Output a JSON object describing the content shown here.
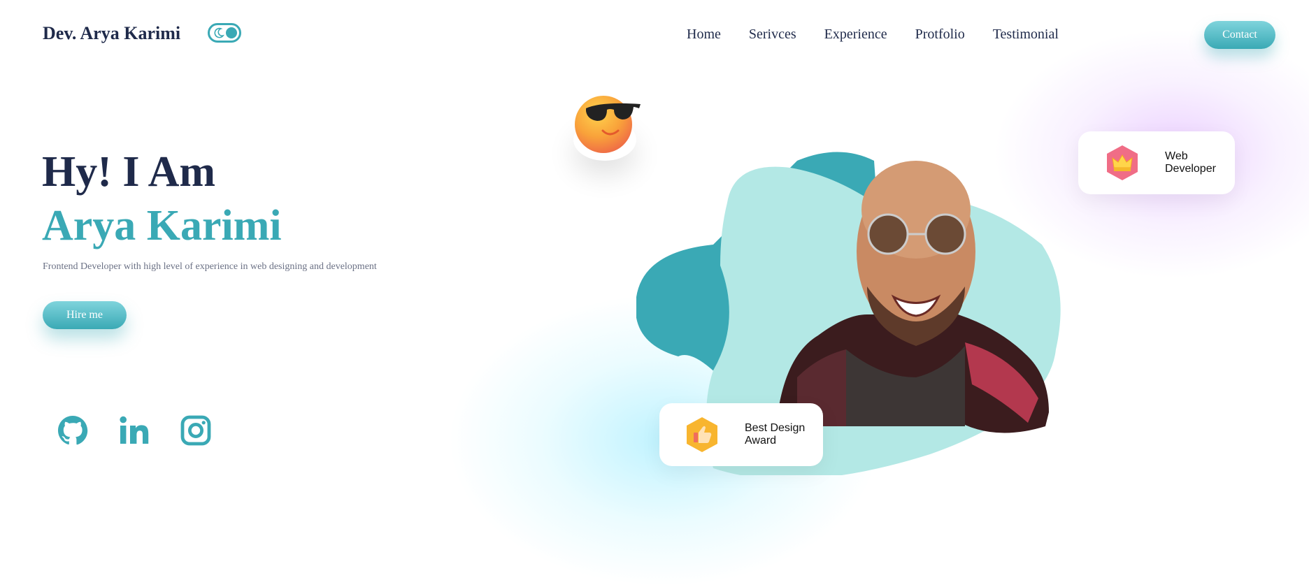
{
  "header": {
    "logo": "Dev. Arya Karimi",
    "nav": [
      "Home",
      "Serivces",
      "Experience",
      "Protfolio",
      "Testimonial"
    ],
    "contact_label": "Contact"
  },
  "hero": {
    "greeting": "Hy! I Am",
    "name": "Arya Karimi",
    "description": "Frontend Developer with high level of experience in web designing and development",
    "hire_label": "Hire me"
  },
  "socials": [
    "github-icon",
    "linkedin-icon",
    "instagram-icon"
  ],
  "cards": {
    "web": {
      "line1": "Web",
      "line2": "Developer",
      "icon": "crown-icon"
    },
    "award": {
      "line1": "Best Design",
      "line2": "Award",
      "icon": "thumbs-up-icon"
    }
  },
  "colors": {
    "accent": "#3aa9b5",
    "accent_light": "#b3e8e5",
    "heading": "#1f2a4a"
  }
}
